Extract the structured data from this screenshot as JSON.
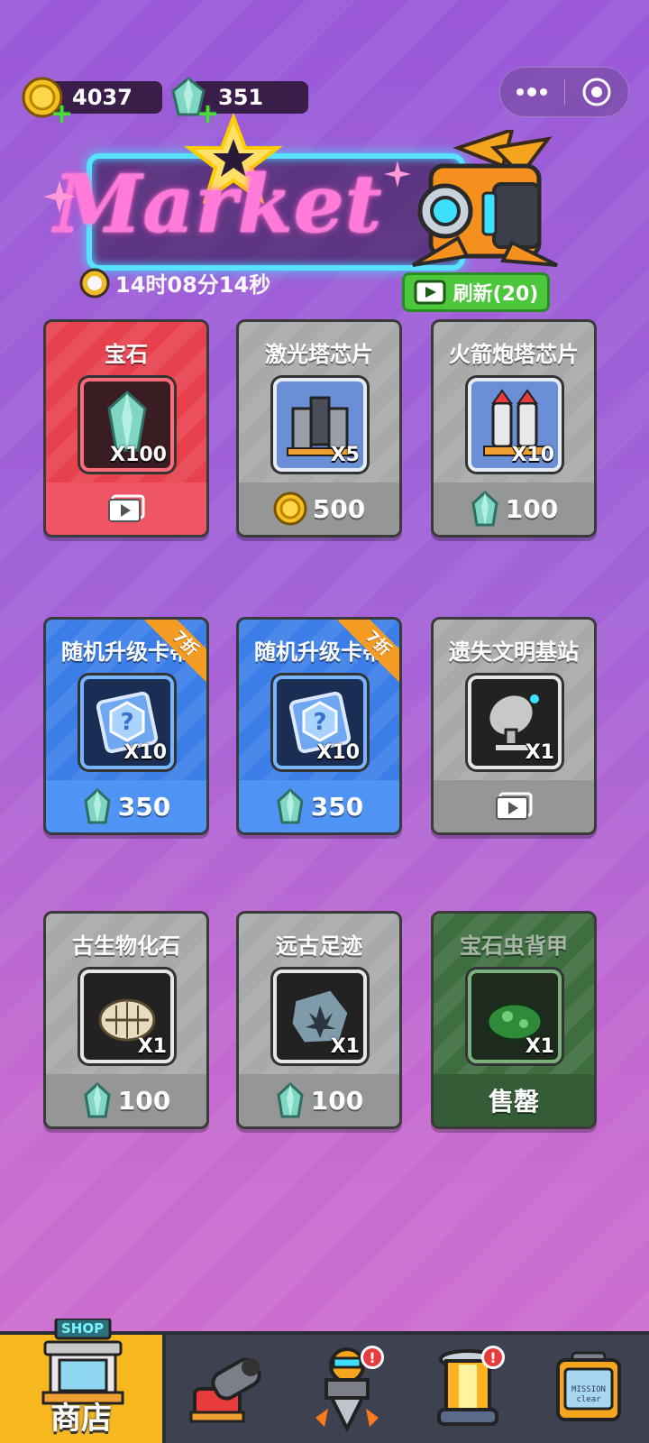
{
  "currency": {
    "coins": "4037",
    "gems": "351"
  },
  "banner": {
    "logo_text": "Market",
    "timer": "14时08分14秒",
    "refresh_label": "刷新(20)"
  },
  "items": [
    {
      "title": "宝石",
      "qty": "X100",
      "price": "",
      "price_type": "ad",
      "style": "red"
    },
    {
      "title": "激光塔芯片",
      "qty": "X5",
      "price": "500",
      "price_type": "coin",
      "style": "gray"
    },
    {
      "title": "火箭炮塔芯片",
      "qty": "X10",
      "price": "100",
      "price_type": "gem",
      "style": "gray"
    },
    {
      "title": "随机升级卡帯",
      "qty": "X10",
      "price": "350",
      "price_type": "gem",
      "style": "blue",
      "badge": "7折"
    },
    {
      "title": "随机升级卡帯",
      "qty": "X10",
      "price": "350",
      "price_type": "gem",
      "style": "blue",
      "badge": "7折"
    },
    {
      "title": "遗失文明基站",
      "qty": "X1",
      "price": "",
      "price_type": "ad",
      "style": "gray"
    },
    {
      "title": "古生物化石",
      "qty": "X1",
      "price": "100",
      "price_type": "gem",
      "style": "gray"
    },
    {
      "title": "远古足迹",
      "qty": "X1",
      "price": "100",
      "price_type": "gem",
      "style": "gray"
    },
    {
      "title": "宝石虫背甲",
      "qty": "X1",
      "price": "售罄",
      "price_type": "soldout",
      "style": "green"
    }
  ],
  "nav": {
    "shop_sign": "SHOP",
    "shop_label": "商店",
    "alert_mark": "!",
    "mission_text": "MISSION clear",
    "tabs": [
      "商店",
      "cannon",
      "drill",
      "tower",
      "mission"
    ]
  },
  "colors": {
    "coin": "#f5c020",
    "gem": "#7fd6c2",
    "accent_pink": "#ff7ad9",
    "neon_blue": "#59e2ff"
  }
}
